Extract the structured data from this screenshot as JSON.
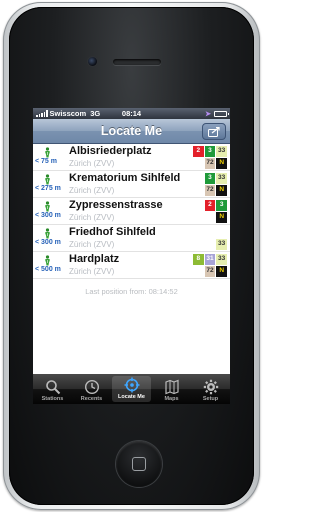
{
  "status": {
    "carrier": "Swisscom",
    "network": "3G",
    "time": "08:14"
  },
  "nav": {
    "title": "Locate Me",
    "right_button_icon": "arrow-in-box-icon"
  },
  "stations": [
    {
      "name": "Albisriederplatz",
      "region": "Zürich (ZVV)",
      "distance": "< 75 m",
      "badges": [
        {
          "text": "2",
          "bg": "#e3202a",
          "fg": "#ffffff"
        },
        {
          "text": "3",
          "bg": "#1f9a3a",
          "fg": "#ffffff"
        },
        {
          "text": "33",
          "bg": "#e7efb0",
          "fg": "#333333"
        },
        {
          "text": "",
          "bg": "transparent",
          "fg": "#000"
        },
        {
          "text": "72",
          "bg": "#d8c6b3",
          "fg": "#333333"
        },
        {
          "text": "N",
          "bg": "#111111",
          "fg": "#f3d400"
        }
      ]
    },
    {
      "name": "Krematorium Sihlfeld",
      "region": "Zürich (ZVV)",
      "distance": "< 275 m",
      "badges": [
        {
          "text": "",
          "bg": "transparent",
          "fg": "#000"
        },
        {
          "text": "3",
          "bg": "#1f9a3a",
          "fg": "#ffffff"
        },
        {
          "text": "33",
          "bg": "#e7efb0",
          "fg": "#333333"
        },
        {
          "text": "",
          "bg": "transparent",
          "fg": "#000"
        },
        {
          "text": "72",
          "bg": "#d8c6b3",
          "fg": "#333333"
        },
        {
          "text": "N",
          "bg": "#111111",
          "fg": "#f3d400"
        }
      ]
    },
    {
      "name": "Zypressenstrasse",
      "region": "Zürich (ZVV)",
      "distance": "< 300 m",
      "badges": [
        {
          "text": "",
          "bg": "transparent",
          "fg": "#000"
        },
        {
          "text": "2",
          "bg": "#e3202a",
          "fg": "#ffffff"
        },
        {
          "text": "3",
          "bg": "#1f9a3a",
          "fg": "#ffffff"
        },
        {
          "text": "",
          "bg": "transparent",
          "fg": "#000"
        },
        {
          "text": "",
          "bg": "transparent",
          "fg": "#000"
        },
        {
          "text": "N",
          "bg": "#111111",
          "fg": "#f3d400"
        }
      ]
    },
    {
      "name": "Friedhof Sihlfeld",
      "region": "Zürich (ZVV)",
      "distance": "< 300 m",
      "badges": [
        {
          "text": "",
          "bg": "transparent",
          "fg": "#000"
        },
        {
          "text": "",
          "bg": "transparent",
          "fg": "#000"
        },
        {
          "text": "",
          "bg": "transparent",
          "fg": "#000"
        },
        {
          "text": "",
          "bg": "transparent",
          "fg": "#000"
        },
        {
          "text": "",
          "bg": "transparent",
          "fg": "#000"
        },
        {
          "text": "33",
          "bg": "#e7efb0",
          "fg": "#333333"
        }
      ]
    },
    {
      "name": "Hardplatz",
      "region": "Zürich (ZVV)",
      "distance": "< 500 m",
      "badges": [
        {
          "text": "8",
          "bg": "#8dbb34",
          "fg": "#ffffff"
        },
        {
          "text": "31",
          "bg": "#a7a3d6",
          "fg": "#ffffff"
        },
        {
          "text": "33",
          "bg": "#e7efb0",
          "fg": "#333333"
        },
        {
          "text": "",
          "bg": "transparent",
          "fg": "#000"
        },
        {
          "text": "72",
          "bg": "#d8c6b3",
          "fg": "#333333"
        },
        {
          "text": "N",
          "bg": "#111111",
          "fg": "#f3d400"
        }
      ]
    }
  ],
  "last_position": "Last position from: 08:14:52",
  "tabs": [
    {
      "label": "Stations",
      "icon": "magnifier-icon"
    },
    {
      "label": "Recents",
      "icon": "clock-icon"
    },
    {
      "label": "Locate Me",
      "icon": "crosshair-icon"
    },
    {
      "label": "Maps",
      "icon": "map-icon"
    },
    {
      "label": "Setup",
      "icon": "gear-icon"
    }
  ],
  "colors": {
    "distance": "#2762b8",
    "nav_bar": "#7a92b0",
    "tab_active_label": "#ffffff"
  }
}
